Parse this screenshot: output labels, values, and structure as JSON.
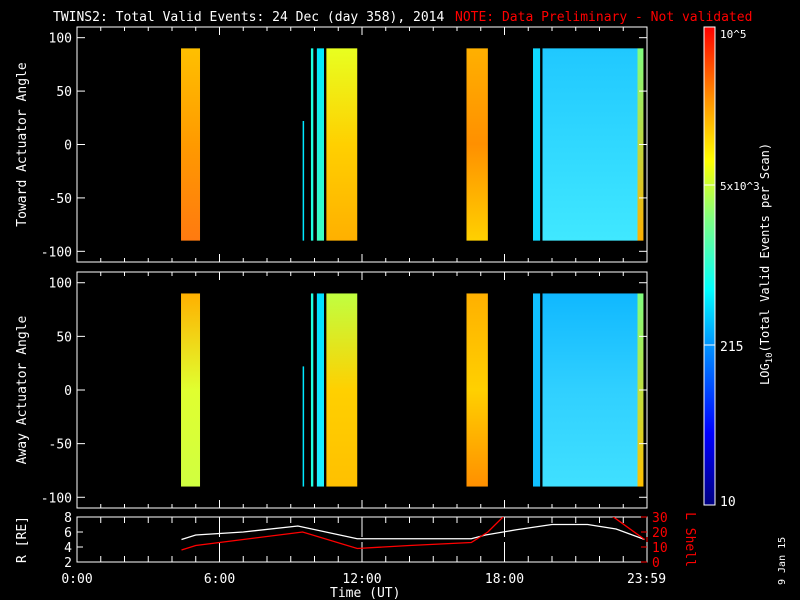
{
  "chart_data": {
    "type": "heatmap",
    "title": "TWINS2: Total Valid Events: 24 Dec (day 358), 2014",
    "note": "NOTE: Data Preliminary - Not validated",
    "colors": {
      "note": "#ff0000",
      "axis": "#ffffff",
      "lshell": "#ff0000",
      "rline": "#ffffff"
    },
    "xlabel": "Time (UT)",
    "xlim": [
      0,
      24
    ],
    "xticks": [
      {
        "h": 0,
        "label": "0:00"
      },
      {
        "h": 6,
        "label": "6:00"
      },
      {
        "h": 12,
        "label": "12:00"
      },
      {
        "h": 18,
        "label": "18:00"
      },
      {
        "h": 23.98,
        "label": "23:59"
      }
    ],
    "datestamp": "9 Jan 15",
    "panels": [
      {
        "ylabel": "Toward Actuator Angle",
        "ylim": [
          -110,
          110
        ],
        "yticks": [
          100,
          50,
          0,
          -50,
          -100
        ],
        "segments": [
          {
            "t0": 4.38,
            "t1": 5.18,
            "a0": -90,
            "a1": 90,
            "colors": [
              "#ffc000",
              "#ff9a00",
              "#ff7a10"
            ]
          },
          {
            "t0": 9.5,
            "t1": 9.56,
            "a0": -90,
            "a1": 22,
            "colors": [
              "#00e8ff",
              "#00e8ff"
            ]
          },
          {
            "t0": 9.85,
            "t1": 9.95,
            "a0": -90,
            "a1": 90,
            "colors": [
              "#20ffe0",
              "#20ffe0"
            ]
          },
          {
            "t0": 10.1,
            "t1": 10.4,
            "a0": -90,
            "a1": 90,
            "colors": [
              "#00e8ff",
              "#40ffc0"
            ]
          },
          {
            "t0": 10.5,
            "t1": 11.8,
            "a0": -90,
            "a1": 90,
            "colors": [
              "#e8ff20",
              "#ffd000",
              "#ffb000"
            ]
          },
          {
            "t0": 16.4,
            "t1": 17.3,
            "a0": -90,
            "a1": 90,
            "colors": [
              "#ffb000",
              "#ff9000",
              "#ffd000"
            ]
          },
          {
            "t0": 19.2,
            "t1": 19.5,
            "a0": -90,
            "a1": 90,
            "colors": [
              "#10d8ff",
              "#10d8ff"
            ]
          },
          {
            "t0": 19.6,
            "t1": 23.6,
            "a0": -90,
            "a1": 90,
            "colors": [
              "#20c8ff",
              "#30d8ff",
              "#40e8ff"
            ]
          },
          {
            "t0": 23.6,
            "t1": 23.85,
            "a0": -90,
            "a1": 90,
            "colors": [
              "#80ff80",
              "#ffb000"
            ]
          }
        ]
      },
      {
        "ylabel": "Away Actuator Angle",
        "ylim": [
          -110,
          110
        ],
        "yticks": [
          100,
          50,
          0,
          -50,
          -100
        ],
        "segments": [
          {
            "t0": 4.38,
            "t1": 5.18,
            "a0": -90,
            "a1": 90,
            "colors": [
              "#ffb000",
              "#e0ff30",
              "#d0ff40"
            ]
          },
          {
            "t0": 9.5,
            "t1": 9.56,
            "a0": -90,
            "a1": 22,
            "colors": [
              "#00e8ff",
              "#00e8ff"
            ]
          },
          {
            "t0": 9.85,
            "t1": 9.95,
            "a0": -90,
            "a1": 90,
            "colors": [
              "#20ffe0",
              "#20ffe0"
            ]
          },
          {
            "t0": 10.1,
            "t1": 10.4,
            "a0": -90,
            "a1": 90,
            "colors": [
              "#00e0ff",
              "#20f0ff"
            ]
          },
          {
            "t0": 10.5,
            "t1": 11.8,
            "a0": -90,
            "a1": 90,
            "colors": [
              "#c0ff40",
              "#ffd000",
              "#ffc000"
            ]
          },
          {
            "t0": 16.4,
            "t1": 17.3,
            "a0": -90,
            "a1": 90,
            "colors": [
              "#ffb000",
              "#ffd000",
              "#ff9000"
            ]
          },
          {
            "t0": 19.2,
            "t1": 19.5,
            "a0": -90,
            "a1": 90,
            "colors": [
              "#10c0ff",
              "#10c0ff"
            ]
          },
          {
            "t0": 19.6,
            "t1": 23.6,
            "a0": -90,
            "a1": 90,
            "colors": [
              "#10b8ff",
              "#30d0ff",
              "#40e0ff"
            ]
          },
          {
            "t0": 23.6,
            "t1": 23.85,
            "a0": -90,
            "a1": 90,
            "colors": [
              "#80ff80",
              "#ffc000"
            ]
          }
        ]
      }
    ],
    "colorbar": {
      "label": "LOG10(Total Valid Events per Scan)",
      "range": [
        10,
        100000
      ],
      "ticks": [
        {
          "value": 10,
          "label": "10"
        },
        {
          "value": 215,
          "label": "215"
        },
        {
          "value": 5000,
          "label": "5x10^3"
        },
        {
          "value": 100000,
          "label": "10^5"
        }
      ]
    },
    "orbit": {
      "r_label": "R [RE]",
      "r_lim": [
        2,
        8
      ],
      "r_ticks": [
        2,
        4,
        6,
        8
      ],
      "l_label": "L Shell",
      "l_lim": [
        0,
        30
      ],
      "l_ticks": [
        0,
        10,
        20,
        30
      ],
      "r_series": [
        [
          4.4,
          5.0
        ],
        [
          5.0,
          5.6
        ],
        [
          7.0,
          6.0
        ],
        [
          9.3,
          6.8
        ],
        [
          11.8,
          5.1
        ],
        [
          16.6,
          5.1
        ],
        [
          17.2,
          5.6
        ],
        [
          18.5,
          6.3
        ],
        [
          20.0,
          7.0
        ],
        [
          21.5,
          7.0
        ],
        [
          22.7,
          6.4
        ],
        [
          23.9,
          5.0
        ]
      ],
      "l_series": [
        [
          4.4,
          8
        ],
        [
          5.0,
          11
        ],
        [
          7.0,
          15
        ],
        [
          9.5,
          20
        ],
        [
          11.8,
          9
        ],
        [
          14.0,
          11
        ],
        [
          16.6,
          13
        ],
        [
          17.3,
          20
        ],
        [
          18.0,
          31
        ]
      ],
      "l_series2": [
        [
          22.5,
          31
        ],
        [
          23.9,
          15
        ]
      ]
    }
  }
}
